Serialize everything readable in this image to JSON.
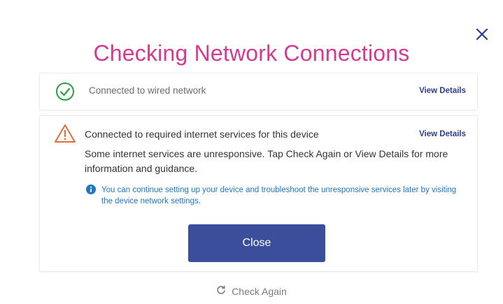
{
  "dialog": {
    "title": "Checking Network Connections",
    "close_icon": "close-icon",
    "title_color": "#d63a8e"
  },
  "checks": [
    {
      "status": "success",
      "icon": "check-circle-icon",
      "text": "Connected to wired network",
      "link": "View Details"
    },
    {
      "status": "warning",
      "icon": "warning-triangle-icon",
      "text": "Connected to required internet services for this device",
      "link": "View Details",
      "description": "Some internet services are unresponsive. Tap Check Again or View Details for more information and guidance.",
      "info": {
        "icon": "info-icon",
        "text": "You can continue setting up your device and troubleshoot the unresponsive services later by visiting the device network settings."
      }
    }
  ],
  "actions": {
    "close_label": "Close",
    "check_again_label": "Check Again",
    "check_again_icon": "refresh-icon"
  },
  "colors": {
    "success": "#2e9e44",
    "warning": "#e0703a",
    "info": "#1f76c6",
    "primary_button": "#3b4e9c",
    "link": "#2c3e8f"
  }
}
